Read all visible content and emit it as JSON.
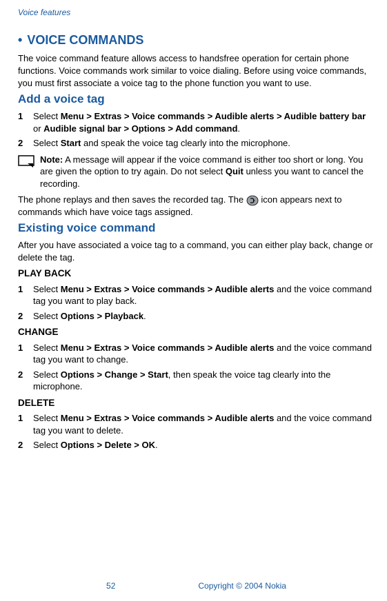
{
  "header": {
    "section": "Voice features"
  },
  "title": {
    "bullet": "•",
    "text": "VOICE COMMANDS"
  },
  "intro": "The voice command feature allows access to handsfree operation for certain phone functions. Voice commands work similar to voice dialing. Before using voice commands, you must first associate a voice tag to the phone function you want to use.",
  "add": {
    "heading": "Add a voice tag",
    "step1": {
      "num": "1",
      "pre": "Select ",
      "bold": "Menu > Extras > Voice commands > Audible alerts > Audible battery bar",
      "mid": " or ",
      "bold2": "Audible signal bar > Options > Add command",
      "post": "."
    },
    "step2": {
      "num": "2",
      "pre": "Select ",
      "bold": "Start",
      "post": " and speak the voice tag clearly into the microphone."
    },
    "note": {
      "label": "Note:",
      "text1": " A message will appear if the voice command is either too short or long. You are given the option to try again. Do not select ",
      "bold": "Quit",
      "text2": " unless you want to cancel the recording."
    },
    "after": {
      "pre": "The phone replays and then saves the recorded tag. The ",
      "post": " icon appears next to commands which have voice tags assigned."
    }
  },
  "existing": {
    "heading": "Existing voice command",
    "intro": "After you have associated a voice tag to a command, you can either play back, change or delete the tag.",
    "playback": {
      "heading": "PLAY BACK",
      "step1": {
        "num": "1",
        "pre": "Select ",
        "bold": "Menu > Extras > Voice commands > Audible alerts",
        "post": " and the voice command tag you want to play back."
      },
      "step2": {
        "num": "2",
        "pre": "Select ",
        "bold": "Options > Playback",
        "post": "."
      }
    },
    "change": {
      "heading": "CHANGE",
      "step1": {
        "num": "1",
        "pre": "Select ",
        "bold": "Menu > Extras > Voice commands > Audible alerts",
        "post": " and the voice command tag you want to change."
      },
      "step2": {
        "num": "2",
        "pre": "Select ",
        "bold": "Options > Change > Start",
        "post": ", then speak the voice tag clearly into the microphone."
      }
    },
    "delete": {
      "heading": "DELETE",
      "step1": {
        "num": "1",
        "pre": "Select ",
        "bold": "Menu > Extras > Voice commands > Audible alerts",
        "post": " and the voice command tag you want to delete."
      },
      "step2": {
        "num": "2",
        "pre": "Select ",
        "bold": "Options > Delete > OK",
        "post": "."
      }
    }
  },
  "footer": {
    "page": "52",
    "copyright": "Copyright © 2004 Nokia"
  }
}
